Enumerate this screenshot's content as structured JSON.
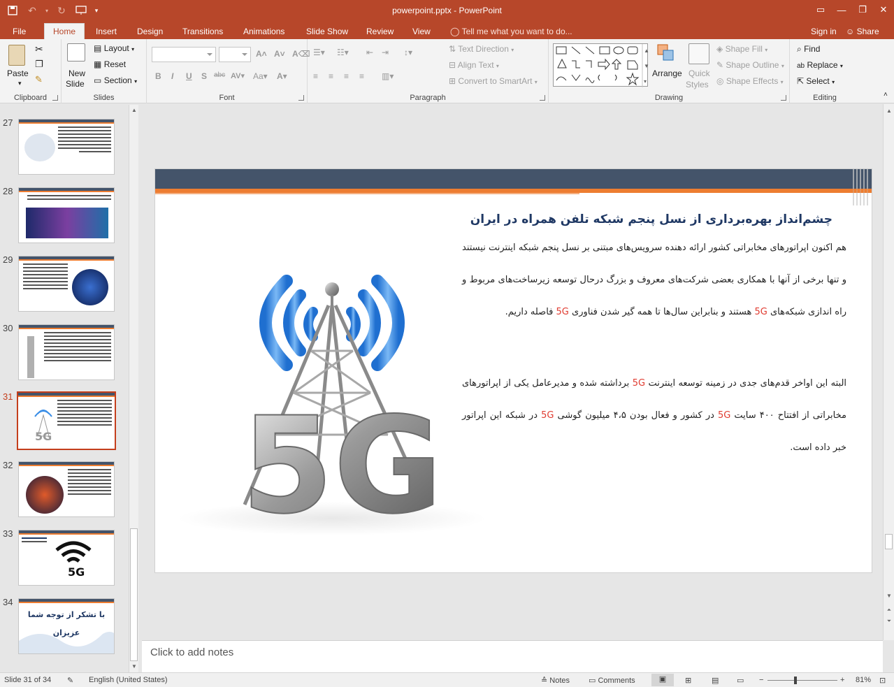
{
  "window": {
    "title": "powerpoint.pptx - PowerPoint",
    "minimize_icon": "minimize-icon",
    "restore_icon": "restore-icon",
    "close_icon": "close-icon"
  },
  "ribbon_tabs": {
    "file": "File",
    "home": "Home",
    "insert": "Insert",
    "design": "Design",
    "transitions": "Transitions",
    "animations": "Animations",
    "slideshow": "Slide Show",
    "review": "Review",
    "view": "View",
    "tellme": "Tell me what you want to do...",
    "signin": "Sign in",
    "share": "Share"
  },
  "ribbon": {
    "clipboard": {
      "label": "Clipboard",
      "paste": "Paste"
    },
    "slides": {
      "label": "Slides",
      "new_slide": "New",
      "new_slide2": "Slide",
      "layout": "Layout",
      "reset": "Reset",
      "section": "Section"
    },
    "font": {
      "label": "Font"
    },
    "paragraph": {
      "label": "Paragraph",
      "text_direction": "Text Direction",
      "align_text": "Align Text",
      "convert_smartart": "Convert to SmartArt"
    },
    "drawing": {
      "label": "Drawing",
      "arrange": "Arrange",
      "quick_styles": "Quick",
      "quick_styles2": "Styles",
      "shape_fill": "Shape Fill",
      "shape_outline": "Shape Outline",
      "shape_effects": "Shape Effects"
    },
    "editing": {
      "label": "Editing",
      "find": "Find",
      "replace": "Replace",
      "select": "Select"
    }
  },
  "thumbnails": {
    "n27": "27",
    "n28": "28",
    "n29": "29",
    "n30": "30",
    "n31": "31",
    "n32": "32",
    "n33": "33",
    "n34": "34",
    "t33_text": "5G",
    "t34_line1": "با تشکر از توجه شما",
    "t34_line2": "عزیزان"
  },
  "slide": {
    "title": "چشم‌انداز بهره‌برداری از نسل پنجم شبکه تلفن همراه در ایران",
    "p1_a": "هم اکنون اپراتورهای مخابراتی کشور ارائه دهنده سرویس‌های مبتنی بر نسل پنجم شبکه اینترنت نیستند و تنها برخی از آنها با همکاری بعضی شرکت‌های معروف و بزرگ درحال توسعه زیرساخت‌های مربوط و راه اندازی شبکه‌های",
    "p1_5g": "5G",
    "p1_b": "هستند و بنابراین سال‌ها تا همه گیر شدن فناوری",
    "p1_5g2": "5G",
    "p1_c": "فاصله داریم.",
    "p2_a": "البته این اواخر قدم‌های جدی در زمینه توسعه اینترنت",
    "p2_5g": "5G",
    "p2_b": "برداشته شده و مدیرعامل یکی از اپراتورهای مخابراتی از افتتاح ۴۰۰ سایت",
    "p2_5g2": "5G",
    "p2_c": "در کشور و فعال بودن ۴،۵ میلیون گوشی",
    "p2_5g3": "5G",
    "p2_d": "در شبکه این اپراتور خبر داده است.",
    "image_text": "5G"
  },
  "notes": {
    "placeholder": "Click to add notes"
  },
  "status": {
    "slide_count": "Slide 31 of 34",
    "language": "English (United States)",
    "notes": "Notes",
    "comments": "Comments",
    "zoom": "81%"
  },
  "colors": {
    "accent": "#b7472a",
    "navy": "#44546a",
    "orange": "#ed7d31",
    "title": "#1f3864",
    "highlight": "#e03c31"
  }
}
